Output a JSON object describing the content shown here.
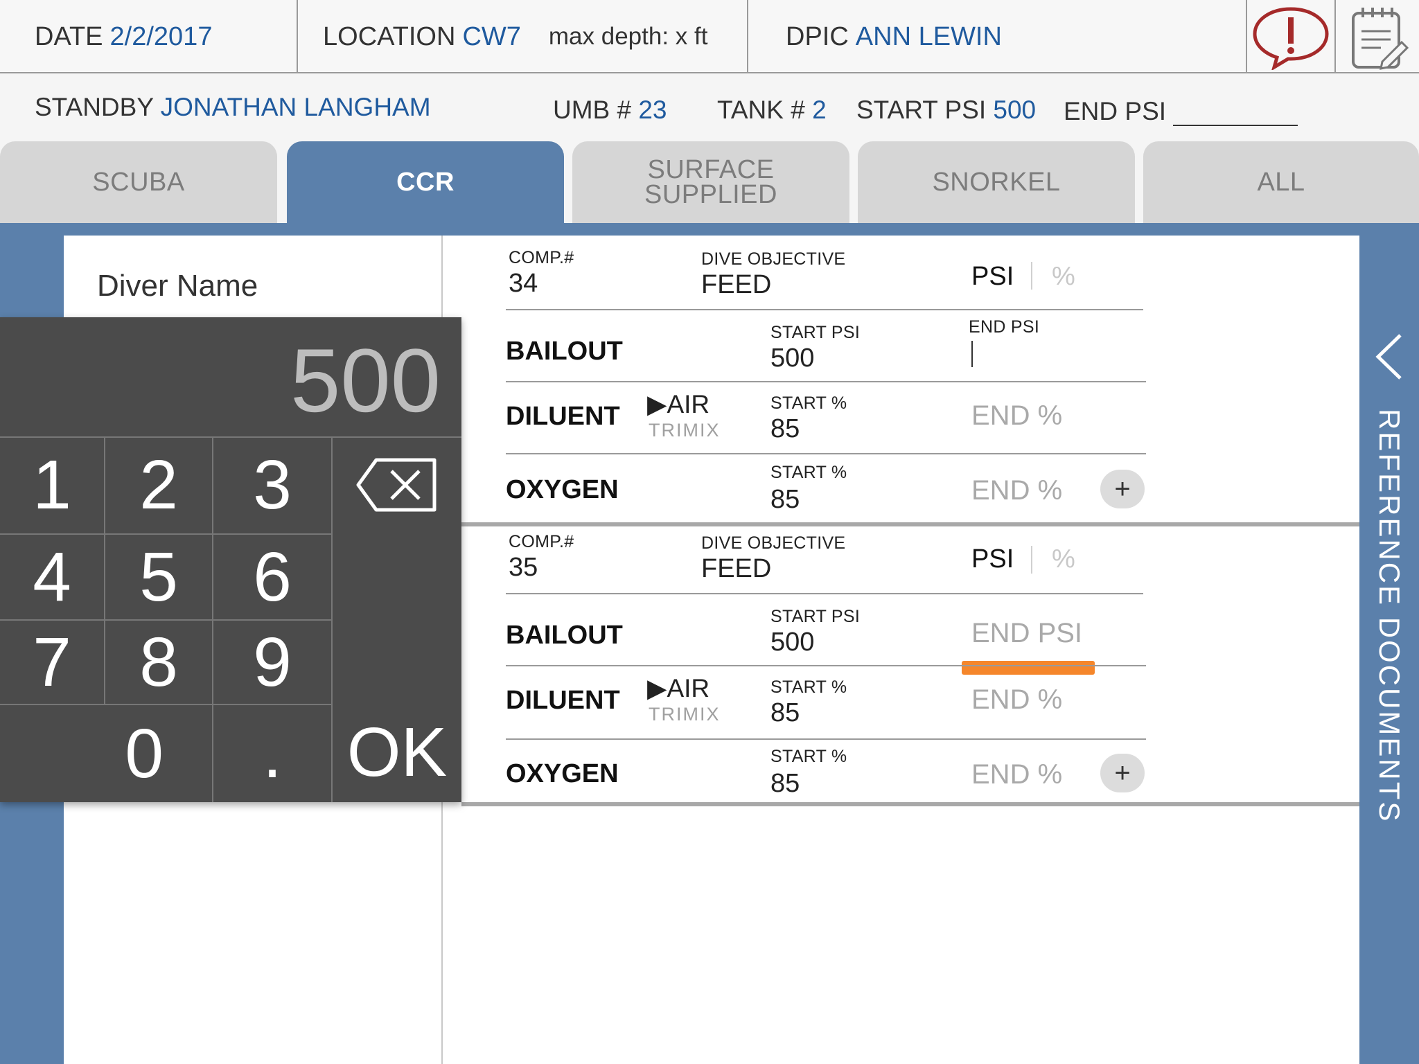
{
  "header": {
    "date_label": "DATE",
    "date_value": "2/2/2017",
    "location_label": "LOCATION",
    "location_value": "CW7",
    "max_depth": "max depth: x ft",
    "dpic_label": "DPIC",
    "dpic_value": "ANN LEWIN",
    "alert_icon": "alert-speech-bubble-icon",
    "notes_icon": "notepad-icon"
  },
  "crew": {
    "standby_label": "STANDBY",
    "standby_value": "JONATHAN LANGHAM",
    "umb_label": "UMB #",
    "umb_value": "23",
    "tank_label": "TANK #",
    "tank_value": "2",
    "start_psi_label": "START PSI",
    "start_psi_value": "500",
    "end_psi_label": "END PSI",
    "end_psi_value": ""
  },
  "tabs": [
    {
      "label": "SCUBA",
      "active": false
    },
    {
      "label": "CCR",
      "active": true
    },
    {
      "label": "SURFACE SUPPLIED",
      "active": false
    },
    {
      "label": "SNORKEL",
      "active": false
    },
    {
      "label": "ALL",
      "active": false
    }
  ],
  "diver_name_placeholder": "Diver Name",
  "reference_documents": "REFERENCE DOCUMENTS",
  "keypad": {
    "display": "500",
    "keys": [
      "1",
      "2",
      "3",
      "4",
      "5",
      "6",
      "7",
      "8",
      "9",
      "0",
      "."
    ],
    "ok": "OK",
    "backspace_icon": "backspace-icon"
  },
  "compartments": [
    {
      "comp_label": "COMP.#",
      "comp_value": "34",
      "objective_label": "DIVE OBJECTIVE",
      "objective_value": "FEED",
      "unit_psi": "PSI",
      "unit_pct": "%",
      "bailout": {
        "label": "BAILOUT",
        "start_label": "START PSI",
        "start_value": "500",
        "end_label": "END PSI",
        "end_value": ""
      },
      "diluent": {
        "label": "DILUENT",
        "gas_selected": "AIR",
        "gas_alt": "TRIMIX",
        "start_label": "START %",
        "start_value": "85",
        "end_placeholder": "END %"
      },
      "oxygen": {
        "label": "OXYGEN",
        "start_label": "START %",
        "start_value": "85",
        "end_placeholder": "END %"
      },
      "add_label": "+"
    },
    {
      "comp_label": "COMP.#",
      "comp_value": "35",
      "objective_label": "DIVE OBJECTIVE",
      "objective_value": "FEED",
      "unit_psi": "PSI",
      "unit_pct": "%",
      "bailout": {
        "label": "BAILOUT",
        "start_label": "START PSI",
        "start_value": "500",
        "end_placeholder": "END PSI"
      },
      "diluent": {
        "label": "DILUENT",
        "gas_selected": "AIR",
        "gas_alt": "TRIMIX",
        "start_label": "START %",
        "start_value": "85",
        "end_placeholder": "END %"
      },
      "oxygen": {
        "label": "OXYGEN",
        "start_label": "START %",
        "start_value": "85",
        "end_placeholder": "END %"
      },
      "add_label": "+"
    }
  ],
  "colors": {
    "accent_blue": "#5b80ab",
    "value_blue": "#1f5a9e",
    "alert_red": "#a52a2a",
    "highlight_orange": "#f5862b",
    "keypad_bg": "#4b4b4b"
  }
}
